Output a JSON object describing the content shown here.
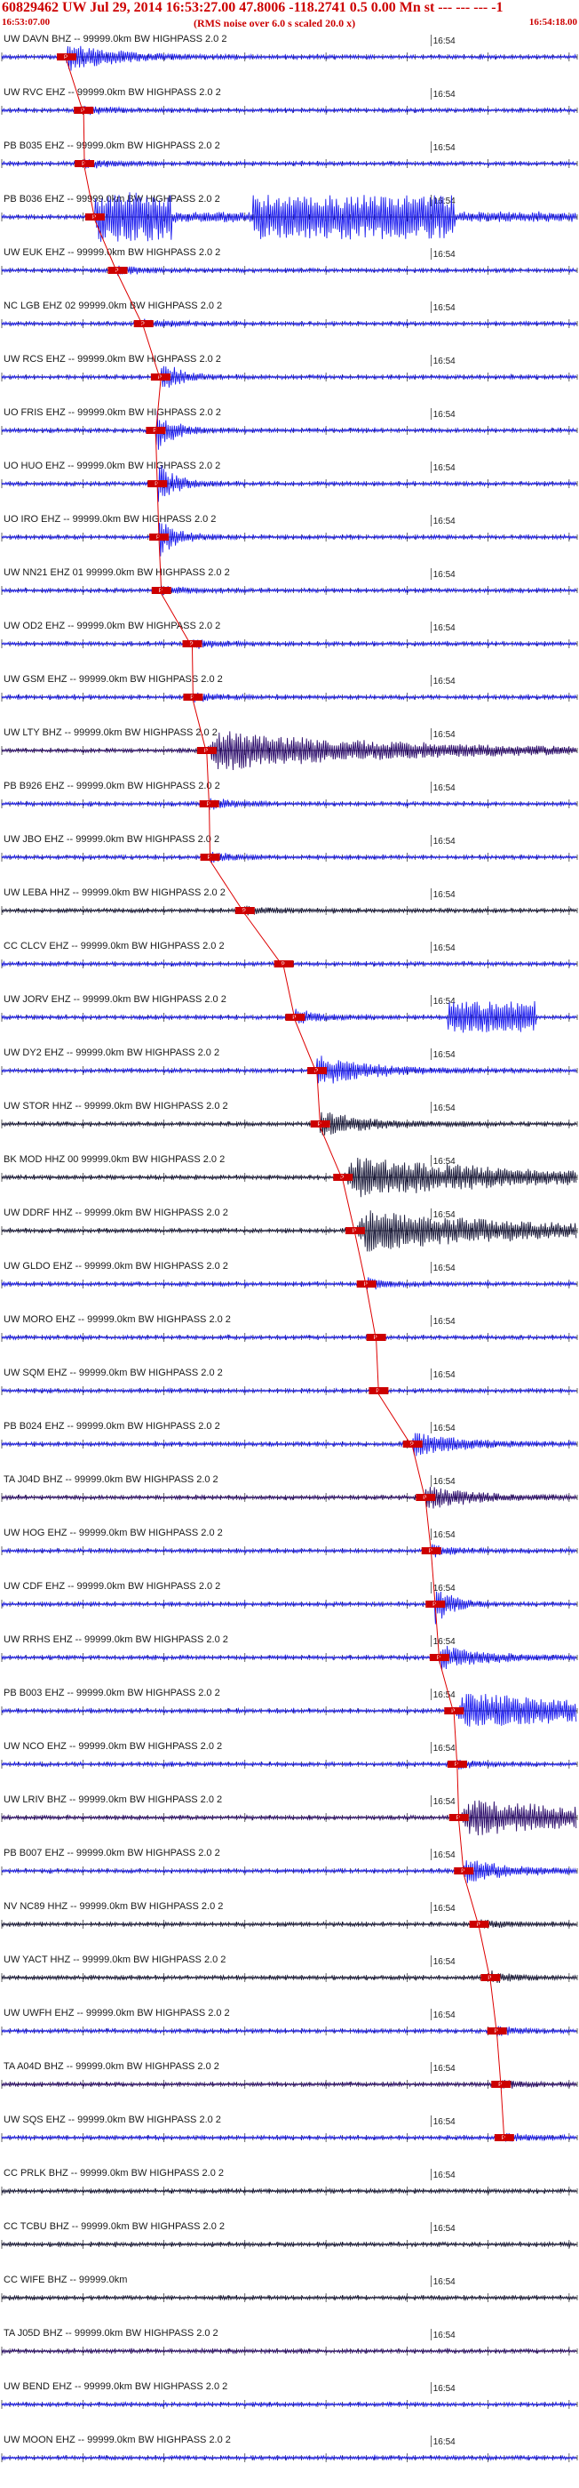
{
  "header": {
    "title": "60829462 UW Jul 29, 2014 16:53:27.00    47.8006 -118.2741   0.5 0.00 Mn st --- --- ---   -1",
    "subtitle": "(RMS noise over 6.0 s scaled 20.0 x)",
    "start_time": "16:53:07.00",
    "end_time": "16:54:18.00"
  },
  "colors": {
    "trace_blue": "#1a1aee",
    "trace_dark": "#1a1a3a",
    "trace_purple": "#2a0a6a",
    "pick_line": "#dd0000",
    "pick_box": "#cc0000",
    "axis": "#000000"
  },
  "chart_data": {
    "type": "line",
    "title": "",
    "time_window": [
      "16:53:07.00",
      "16:54:18.00"
    ],
    "minute_marker": "16:54",
    "minute_marker_time_s": 53,
    "duration_s": 71,
    "pick_label": "P",
    "traces": [
      {
        "label": "UW DAVN BHZ -- 99999.0km BW  HIGHPASS  2.0  2",
        "pick_s": 8.0,
        "color": "blue",
        "amp": 0.6,
        "burst": "medium"
      },
      {
        "label": "UW RVC EHZ -- 99999.0km BW  HIGHPASS  2.0  2",
        "pick_s": 10.1,
        "color": "blue",
        "amp": 0.3,
        "burst": "small"
      },
      {
        "label": "PB B035 EHZ -- 99999.0km BW  HIGHPASS  2.0  2",
        "pick_s": 10.2,
        "color": "blue",
        "amp": 0.3,
        "burst": "small"
      },
      {
        "label": "PB B036 EHZ -- 99999.0km BW  HIGHPASS  2.0  2",
        "pick_s": 11.5,
        "color": "blue",
        "amp": 1.0,
        "burst": "clipped"
      },
      {
        "label": "UW EUK EHZ -- 99999.0km BW  HIGHPASS  2.0  2",
        "pick_s": 14.3,
        "color": "blue",
        "amp": 0.3,
        "burst": "small"
      },
      {
        "label": "NC LGB EHZ 02 99999.0km BW  HIGHPASS  2.0  2",
        "pick_s": 17.5,
        "color": "blue",
        "amp": 0.3,
        "burst": "small"
      },
      {
        "label": "UW RCS EHZ -- 99999.0km BW  HIGHPASS  2.0  2",
        "pick_s": 19.6,
        "color": "blue",
        "amp": 0.8,
        "burst": "large"
      },
      {
        "label": "UO FRIS EHZ -- 99999.0km BW  HIGHPASS  2.0  2",
        "pick_s": 19.0,
        "color": "blue",
        "amp": 0.9,
        "burst": "large"
      },
      {
        "label": "UO HUO EHZ -- 99999.0km BW  HIGHPASS  2.0  2",
        "pick_s": 19.2,
        "color": "blue",
        "amp": 0.9,
        "burst": "large"
      },
      {
        "label": "UO IRO EHZ -- 99999.0km BW  HIGHPASS  2.0  2",
        "pick_s": 19.4,
        "color": "blue",
        "amp": 0.9,
        "burst": "large"
      },
      {
        "label": "UW NN21 EHZ 01 99999.0km BW  HIGHPASS  2.0  2",
        "pick_s": 19.7,
        "color": "blue",
        "amp": 0.3,
        "burst": "small"
      },
      {
        "label": "UW OD2 EHZ -- 99999.0km BW  HIGHPASS  2.0  2",
        "pick_s": 23.5,
        "color": "blue",
        "amp": 0.3,
        "burst": "small"
      },
      {
        "label": "UW GSM EHZ -- 99999.0km BW  HIGHPASS  2.0  2",
        "pick_s": 23.6,
        "color": "blue",
        "amp": 0.3,
        "burst": "small"
      },
      {
        "label": "UW LTY BHZ -- 99999.0km BW  HIGHPASS  2.0  2",
        "pick_s": 25.3,
        "color": "purple",
        "amp": 0.9,
        "burst": "wide"
      },
      {
        "label": "PB B926 EHZ -- 99999.0km BW  HIGHPASS  2.0  2",
        "pick_s": 25.6,
        "color": "blue",
        "amp": 0.4,
        "burst": "small"
      },
      {
        "label": "UW JBO EHZ -- 99999.0km BW  HIGHPASS  2.0  2",
        "pick_s": 25.7,
        "color": "blue",
        "amp": 0.3,
        "burst": "small"
      },
      {
        "label": "UW LEBA HHZ -- 99999.0km BW  HIGHPASS  2.0  2",
        "pick_s": 30.0,
        "color": "dark",
        "amp": 0.3,
        "burst": "small"
      },
      {
        "label": "CC CLCV EHZ -- 99999.0km BW  HIGHPASS  2.0  2",
        "pick_s": 34.8,
        "color": "blue",
        "amp": 0.2,
        "burst": "none"
      },
      {
        "label": "UW JORV EHZ -- 99999.0km BW  HIGHPASS  2.0  2",
        "pick_s": 36.2,
        "color": "blue",
        "amp": 0.7,
        "burst": "late"
      },
      {
        "label": "UW DY2 EHZ -- 99999.0km BW  HIGHPASS  2.0  2",
        "pick_s": 38.9,
        "color": "blue",
        "amp": 0.7,
        "burst": "medium"
      },
      {
        "label": "UW STOR HHZ -- 99999.0km BW  HIGHPASS  2.0  2",
        "pick_s": 39.3,
        "color": "dark",
        "amp": 0.5,
        "burst": "medium"
      },
      {
        "label": "BK MOD HHZ 00 99999.0km BW  HIGHPASS  2.0  2",
        "pick_s": 42.1,
        "color": "dark",
        "amp": 0.9,
        "burst": "wide"
      },
      {
        "label": "UW DDRF HHZ -- 99999.0km BW  HIGHPASS  2.0  2",
        "pick_s": 43.6,
        "color": "dark",
        "amp": 0.9,
        "burst": "wide"
      },
      {
        "label": "UW GLDO EHZ -- 99999.0km BW  HIGHPASS  2.0  2",
        "pick_s": 45.0,
        "color": "blue",
        "amp": 0.4,
        "burst": "small"
      },
      {
        "label": "UW MORO EHZ -- 99999.0km BW  HIGHPASS  2.0  2",
        "pick_s": 46.2,
        "color": "blue",
        "amp": 0.2,
        "burst": "none"
      },
      {
        "label": "UW SQM EHZ -- 99999.0km BW  HIGHPASS  2.0  2",
        "pick_s": 46.5,
        "color": "blue",
        "amp": 0.2,
        "burst": "none"
      },
      {
        "label": "PB B024 EHZ -- 99999.0km BW  HIGHPASS  2.0  2",
        "pick_s": 50.7,
        "color": "blue",
        "amp": 0.5,
        "burst": "medium"
      },
      {
        "label": "TA J04D BHZ -- 99999.0km BW  HIGHPASS  2.0  2",
        "pick_s": 52.3,
        "color": "purple",
        "amp": 0.5,
        "burst": "medium"
      },
      {
        "label": "UW HOG EHZ -- 99999.0km BW  HIGHPASS  2.0  2",
        "pick_s": 53.0,
        "color": "blue",
        "amp": 0.4,
        "burst": "small"
      },
      {
        "label": "UW CDF EHZ -- 99999.0km BW  HIGHPASS  2.0  2",
        "pick_s": 53.5,
        "color": "blue",
        "amp": 0.8,
        "burst": "large"
      },
      {
        "label": "UW RRHS EHZ -- 99999.0km BW  HIGHPASS  2.0  2",
        "pick_s": 54.0,
        "color": "blue",
        "amp": 0.5,
        "burst": "medium"
      },
      {
        "label": "PB B003 EHZ -- 99999.0km BW  HIGHPASS  2.0  2",
        "pick_s": 55.8,
        "color": "blue",
        "amp": 0.8,
        "burst": "wide"
      },
      {
        "label": "UW NCO EHZ -- 99999.0km BW  HIGHPASS  2.0  2",
        "pick_s": 56.2,
        "color": "blue",
        "amp": 0.3,
        "burst": "small"
      },
      {
        "label": "UW LRIV BHZ -- 99999.0km BW  HIGHPASS  2.0  2",
        "pick_s": 56.4,
        "color": "purple",
        "amp": 0.8,
        "burst": "wide"
      },
      {
        "label": "PB B007 EHZ -- 99999.0km BW  HIGHPASS  2.0  2",
        "pick_s": 57.0,
        "color": "blue",
        "amp": 0.5,
        "burst": "medium"
      },
      {
        "label": "NV NC89 HHZ -- 99999.0km BW  HIGHPASS  2.0  2",
        "pick_s": 58.9,
        "color": "dark",
        "amp": 0.3,
        "burst": "small"
      },
      {
        "label": "UW YACT HHZ -- 99999.0km BW  HIGHPASS  2.0  2",
        "pick_s": 60.3,
        "color": "dark",
        "amp": 0.4,
        "burst": "small"
      },
      {
        "label": "UW UWFH EHZ -- 99999.0km BW  HIGHPASS  2.0  2",
        "pick_s": 61.1,
        "color": "blue",
        "amp": 0.3,
        "burst": "small"
      },
      {
        "label": "TA A04D BHZ -- 99999.0km BW  HIGHPASS  2.0  2",
        "pick_s": 61.6,
        "color": "purple",
        "amp": 0.3,
        "burst": "small"
      },
      {
        "label": "UW SQS EHZ -- 99999.0km BW  HIGHPASS  2.0  2",
        "pick_s": 62.0,
        "color": "blue",
        "amp": 0.3,
        "burst": "small"
      },
      {
        "label": "CC PRLK BHZ -- 99999.0km BW  HIGHPASS  2.0  2",
        "pick_s": null,
        "color": "dark",
        "amp": 0.2,
        "burst": "none"
      },
      {
        "label": "CC TCBU BHZ -- 99999.0km BW  HIGHPASS  2.0  2",
        "pick_s": null,
        "color": "dark",
        "amp": 0.2,
        "burst": "none"
      },
      {
        "label": "CC WIFE BHZ -- 99999.0km",
        "pick_s": null,
        "color": "dark",
        "amp": 0.15,
        "burst": "none"
      },
      {
        "label": "TA J05D BHZ -- 99999.0km BW  HIGHPASS  2.0  2",
        "pick_s": null,
        "color": "purple",
        "amp": 0.15,
        "burst": "none"
      },
      {
        "label": "UW BEND EHZ -- 99999.0km BW  HIGHPASS  2.0  2",
        "pick_s": null,
        "color": "blue",
        "amp": 0.15,
        "burst": "none"
      },
      {
        "label": "UW MOON EHZ -- 99999.0km BW  HIGHPASS  2.0  2",
        "pick_s": null,
        "color": "blue",
        "amp": 0.15,
        "burst": "none"
      }
    ]
  }
}
